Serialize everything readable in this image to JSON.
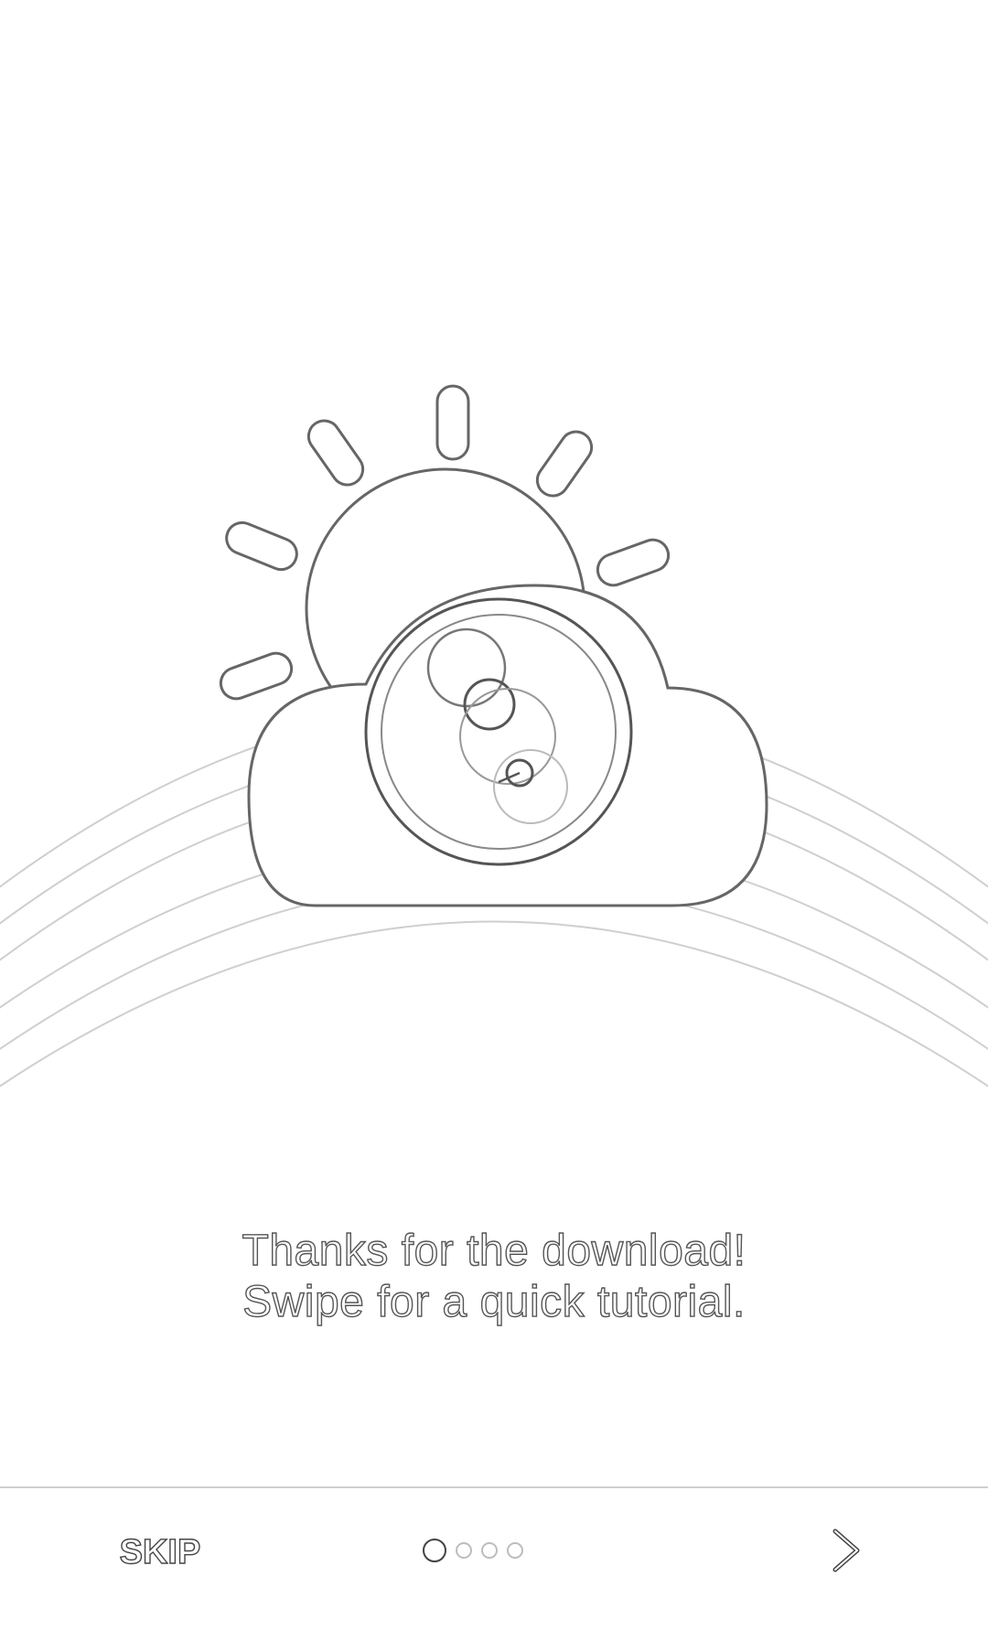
{
  "intro": {
    "line1": "Thanks for the download!",
    "line2": "Swipe for a quick tutorial."
  },
  "footer": {
    "skip_label": "SKIP",
    "pages_total": 4,
    "current_page": 1,
    "next_icon": "chevron-right-icon"
  },
  "illustration": {
    "icon": "sun-cloud-camera-icon"
  },
  "colors": {
    "background": "#ffffff",
    "outline": "#555555",
    "divider": "#cfcfcf"
  }
}
